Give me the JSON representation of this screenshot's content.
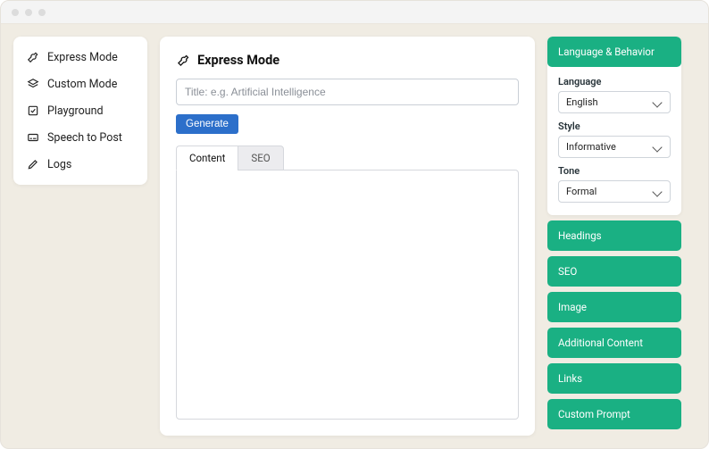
{
  "sidebar": {
    "items": [
      {
        "label": "Express Mode",
        "icon": "wrench-icon"
      },
      {
        "label": "Custom Mode",
        "icon": "layers-icon"
      },
      {
        "label": "Playground",
        "icon": "checkbox-icon"
      },
      {
        "label": "Speech to Post",
        "icon": "subtitle-icon"
      },
      {
        "label": "Logs",
        "icon": "pen-icon"
      }
    ]
  },
  "main": {
    "title": "Express Mode",
    "titlePlaceholder": "Title: e.g. Artificial Intelligence",
    "generateLabel": "Generate",
    "tabs": [
      {
        "label": "Content",
        "active": true
      },
      {
        "label": "SEO",
        "active": false
      }
    ],
    "editorValue": ""
  },
  "settings": {
    "openSection": {
      "header": "Language & Behavior",
      "fields": {
        "language": {
          "label": "Language",
          "value": "English"
        },
        "style": {
          "label": "Style",
          "value": "Informative"
        },
        "tone": {
          "label": "Tone",
          "value": "Formal"
        }
      }
    },
    "collapsed": [
      "Headings",
      "SEO",
      "Image",
      "Additional Content",
      "Links",
      "Custom Prompt"
    ]
  }
}
